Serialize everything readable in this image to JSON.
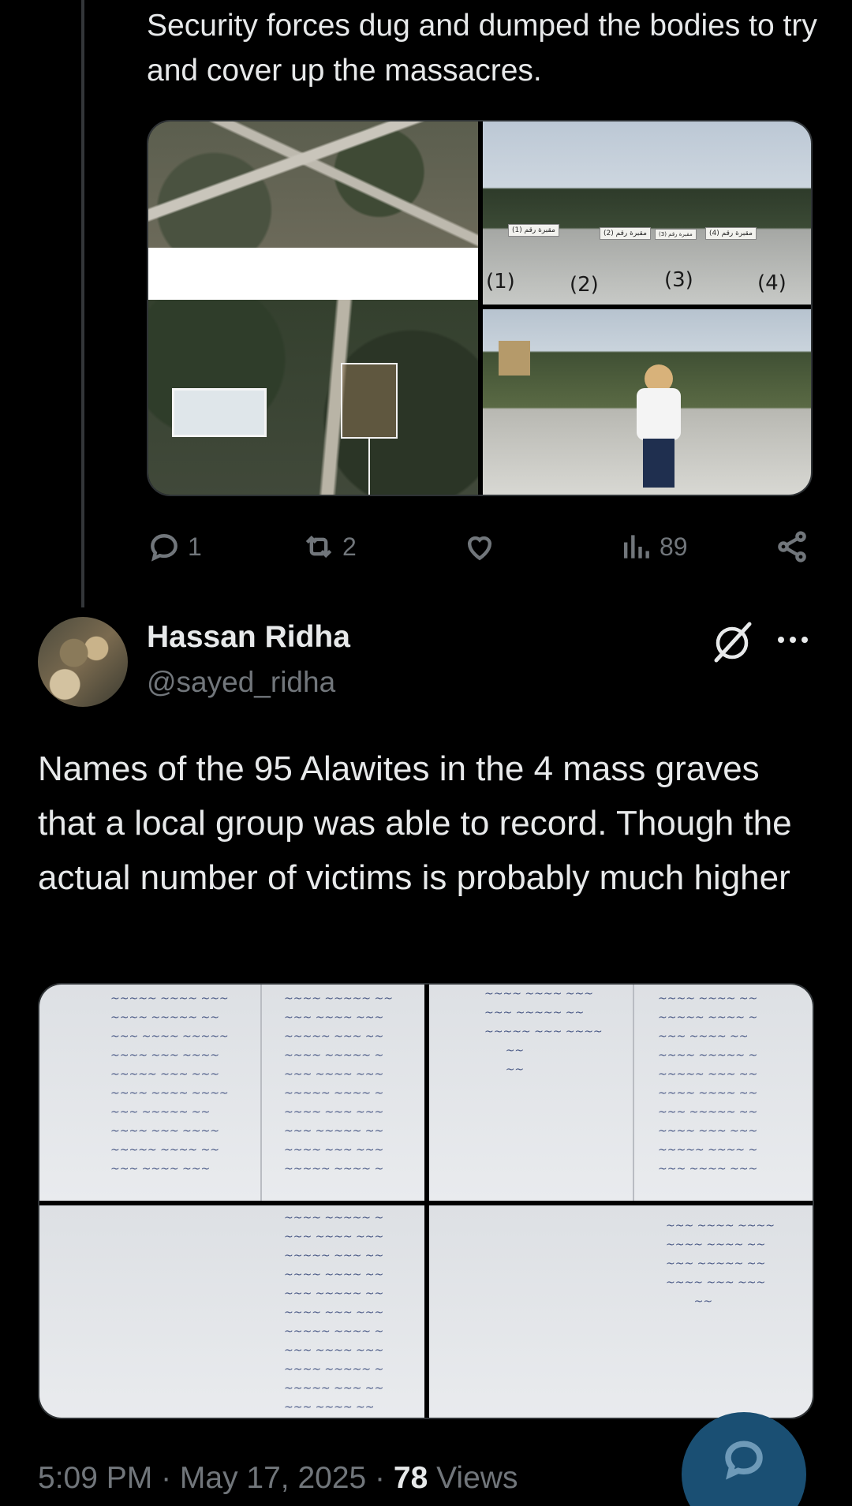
{
  "tweet1": {
    "text": "Security forces dug and dumped the bodies to try and cover up the massacres.",
    "media": {
      "grave_signs": [
        "مقبرة رقم (1)",
        "مقبرة رقم (2)",
        "مقبرة رقم (3)",
        "مقبرة رقم (4)"
      ],
      "grave_numbers": [
        "(1)",
        "(2)",
        "(3)",
        "(4)"
      ]
    },
    "actions": {
      "replies": "1",
      "reposts": "2",
      "likes": "",
      "views": "89"
    }
  },
  "tweet2": {
    "author_name": "Hassan Ridha",
    "author_handle": "@sayed_ridha",
    "text": "Names of the 95 Alawites in the 4 mass graves that a local group was able to record. Though the actual number of victims is probably much higher",
    "timestamp": "5:09 PM · May 17, 2025 · ",
    "views_count": "78",
    "views_label": " Views"
  },
  "icons": {
    "reply": "reply-icon",
    "repost": "repost-icon",
    "like": "heart-icon",
    "views": "analytics-icon",
    "share": "share-icon",
    "grok": "grok-icon",
    "more": "more-icon",
    "compose_reply": "reply-fab-icon"
  },
  "colors": {
    "background": "#000000",
    "text_primary": "#e7e9ea",
    "text_secondary": "#71767b",
    "fab": "#1a4f73"
  }
}
